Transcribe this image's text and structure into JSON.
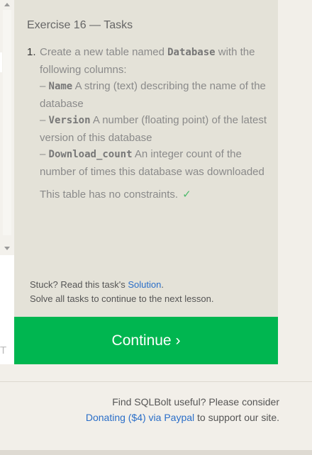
{
  "editor": {
    "run_label": "T"
  },
  "tasks": {
    "title": "Exercise 16 — Tasks",
    "items": [
      {
        "number": "1.",
        "intro_before": "Create a new table named ",
        "table_name": "Database",
        "intro_after": " with the following columns:",
        "columns": [
          {
            "dash": "– ",
            "name": "Name",
            "desc": " A string (text) describing the name of the database"
          },
          {
            "dash": "– ",
            "name": "Version",
            "desc": " A number (floating point) of the latest version of this database"
          },
          {
            "dash": "– ",
            "name": "Download_count",
            "desc": " An integer count of the number of times this database was downloaded"
          }
        ],
        "constraint_text": "This table has no constraints.",
        "check": "✓"
      }
    ],
    "stuck_prefix": "Stuck? Read this task's ",
    "solution_link": "Solution",
    "stuck_suffix": ".",
    "solve_all": "Solve all tasks to continue to the next lesson."
  },
  "continue_button": {
    "label": "Continue ›"
  },
  "footer": {
    "line1": "Find SQLBolt useful? Please consider",
    "donate_link": "Donating ($4) via Paypal",
    "line2_suffix": " to support our site."
  },
  "colors": {
    "accent_green": "#00b650",
    "link_blue": "#2a6ec8",
    "panel_bg": "#e4e2d8"
  }
}
